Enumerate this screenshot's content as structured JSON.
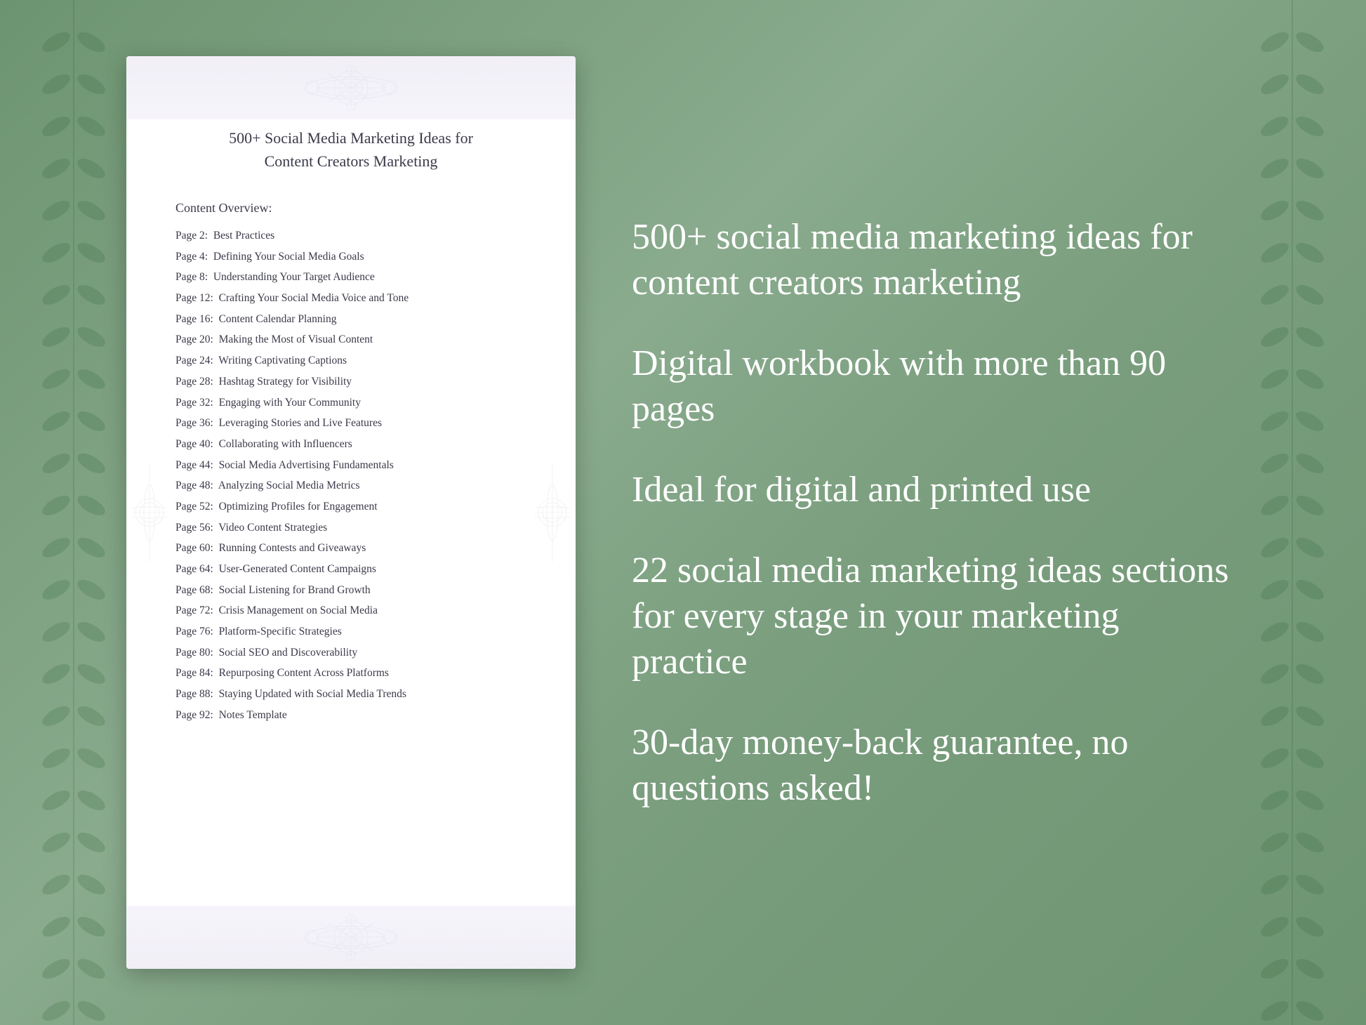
{
  "background": {
    "color": "#7a9e7e"
  },
  "document": {
    "title": "500+ Social Media Marketing Ideas for\nContent Creators Marketing",
    "section_label": "Content Overview:",
    "toc_items": [
      {
        "page": "Page  2:",
        "topic": "Best Practices"
      },
      {
        "page": "Page  4:",
        "topic": "Defining Your Social Media Goals"
      },
      {
        "page": "Page  8:",
        "topic": "Understanding Your Target Audience"
      },
      {
        "page": "Page 12:",
        "topic": "Crafting Your Social Media Voice and Tone"
      },
      {
        "page": "Page 16:",
        "topic": "Content Calendar Planning"
      },
      {
        "page": "Page 20:",
        "topic": "Making the Most of Visual Content"
      },
      {
        "page": "Page 24:",
        "topic": "Writing Captivating Captions"
      },
      {
        "page": "Page 28:",
        "topic": "Hashtag Strategy for Visibility"
      },
      {
        "page": "Page 32:",
        "topic": "Engaging with Your Community"
      },
      {
        "page": "Page 36:",
        "topic": "Leveraging Stories and Live Features"
      },
      {
        "page": "Page 40:",
        "topic": "Collaborating with Influencers"
      },
      {
        "page": "Page 44:",
        "topic": "Social Media Advertising Fundamentals"
      },
      {
        "page": "Page 48:",
        "topic": "Analyzing Social Media Metrics"
      },
      {
        "page": "Page 52:",
        "topic": "Optimizing Profiles for Engagement"
      },
      {
        "page": "Page 56:",
        "topic": "Video Content Strategies"
      },
      {
        "page": "Page 60:",
        "topic": "Running Contests and Giveaways"
      },
      {
        "page": "Page 64:",
        "topic": "User-Generated Content Campaigns"
      },
      {
        "page": "Page 68:",
        "topic": "Social Listening for Brand Growth"
      },
      {
        "page": "Page 72:",
        "topic": "Crisis Management on Social Media"
      },
      {
        "page": "Page 76:",
        "topic": "Platform-Specific Strategies"
      },
      {
        "page": "Page 80:",
        "topic": "Social SEO and Discoverability"
      },
      {
        "page": "Page 84:",
        "topic": "Repurposing Content Across Platforms"
      },
      {
        "page": "Page 88:",
        "topic": "Staying Updated with Social Media Trends"
      },
      {
        "page": "Page 92:",
        "topic": "Notes Template"
      }
    ]
  },
  "features": [
    "500+ social media marketing ideas for content creators marketing",
    "Digital workbook with more than 90 pages",
    "Ideal for digital and printed use",
    "22 social media marketing ideas sections for every stage in your marketing practice",
    "30-day money-back guarantee, no questions asked!"
  ]
}
